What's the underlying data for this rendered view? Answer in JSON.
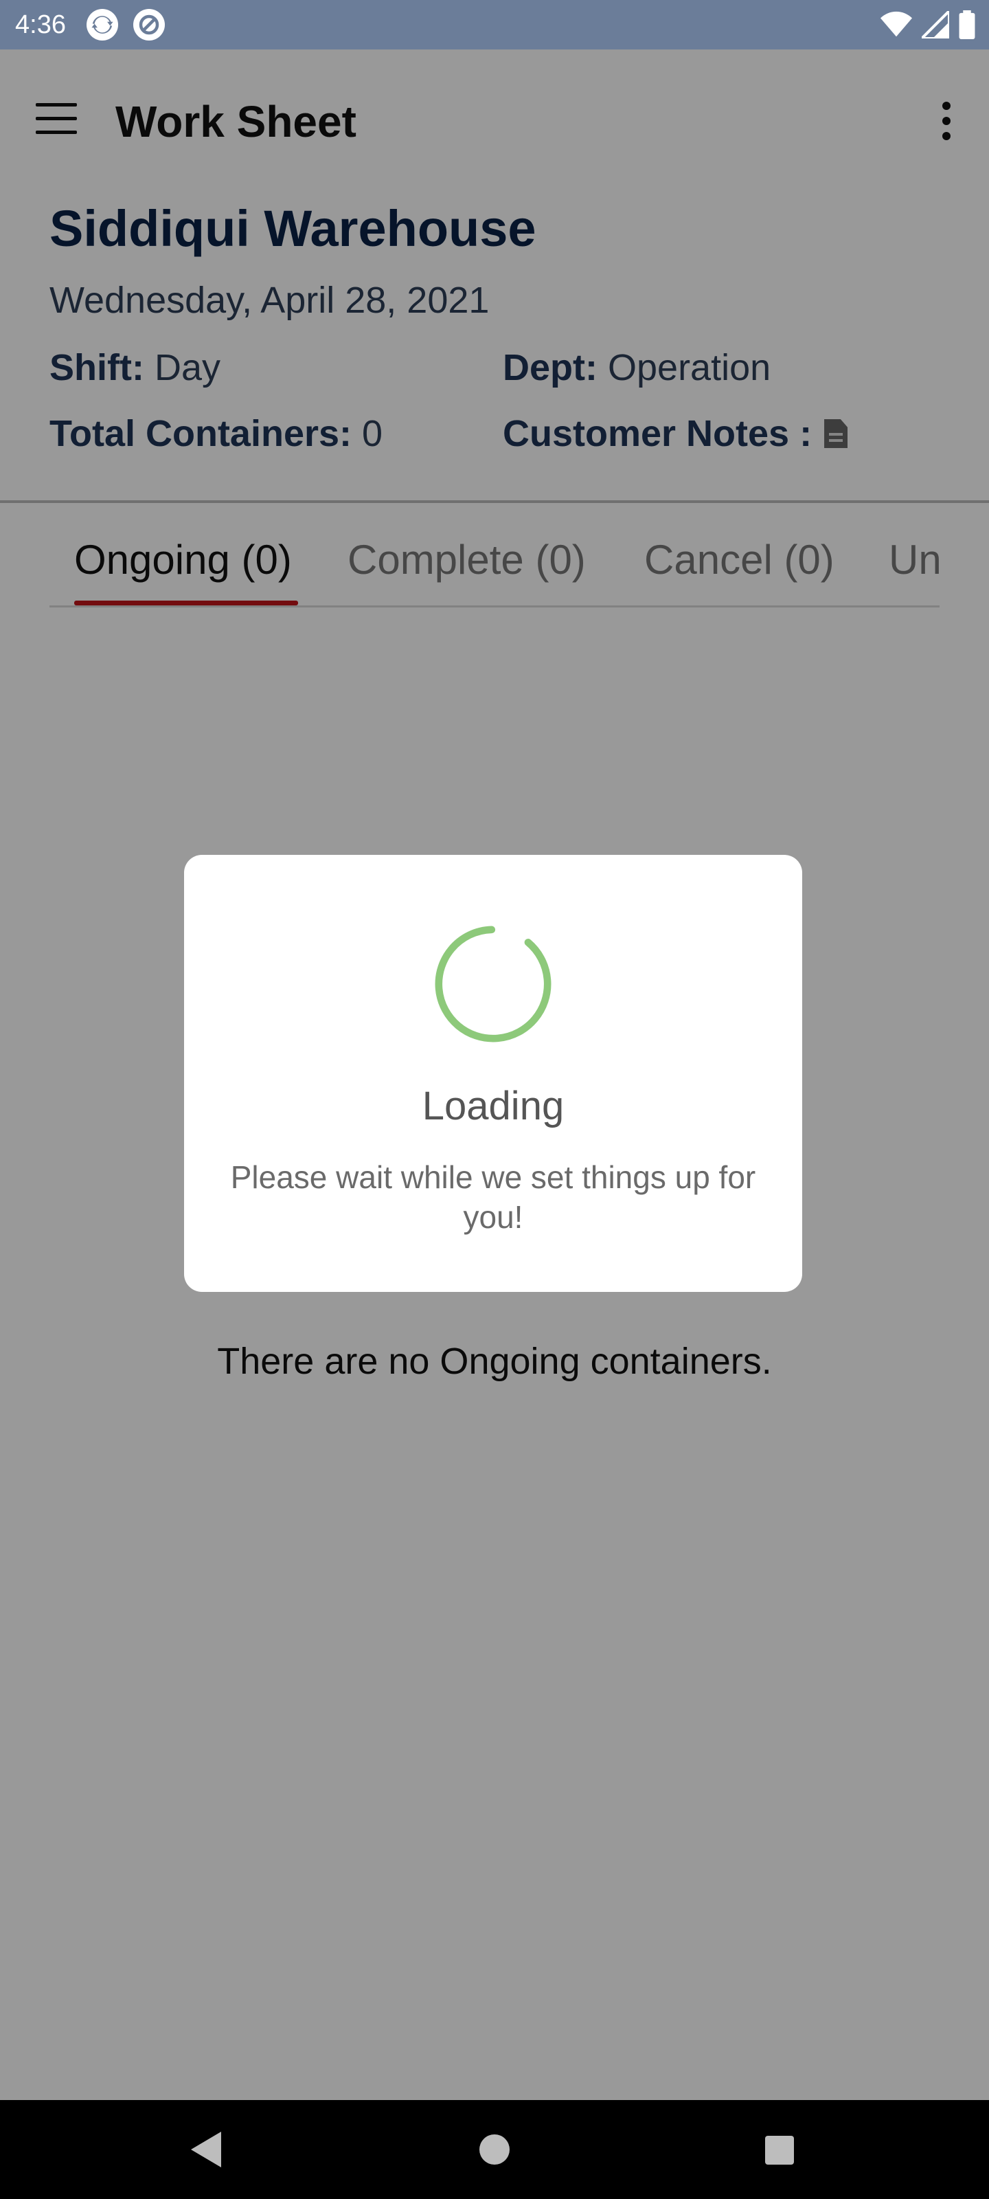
{
  "status_bar": {
    "time": "4:36",
    "icons": [
      "sync-icon",
      "at-icon",
      "wifi-icon",
      "signal-icon",
      "battery-icon"
    ]
  },
  "app_bar": {
    "title": "Work Sheet",
    "menu_icon": "hamburger-menu-icon",
    "overflow_icon": "more-vertical-icon"
  },
  "header": {
    "warehouse_name": "Siddiqui Warehouse",
    "date": "Wednesday, April 28, 2021",
    "shift_label": "Shift:",
    "shift_value": "Day",
    "dept_label": "Dept:",
    "dept_value": "Operation",
    "total_containers_label": "Total Containers:",
    "total_containers_value": "0",
    "customer_notes_label": "Customer Notes :",
    "customer_notes_icon": "document-icon"
  },
  "tabs": [
    {
      "label": "Ongoing (0)",
      "active": true
    },
    {
      "label": "Complete (0)",
      "active": false
    },
    {
      "label": "Cancel (0)",
      "active": false
    },
    {
      "label": "Un",
      "active": false
    }
  ],
  "empty_state": "There are no Ongoing containers.",
  "loading_dialog": {
    "title": "Loading",
    "message": "Please wait while we set things up for you!",
    "spinner_color": "#8dc97a"
  },
  "colors": {
    "status_bar": "#6b7d99",
    "tab_indicator": "#c0141a",
    "heading": "#0b2247"
  }
}
